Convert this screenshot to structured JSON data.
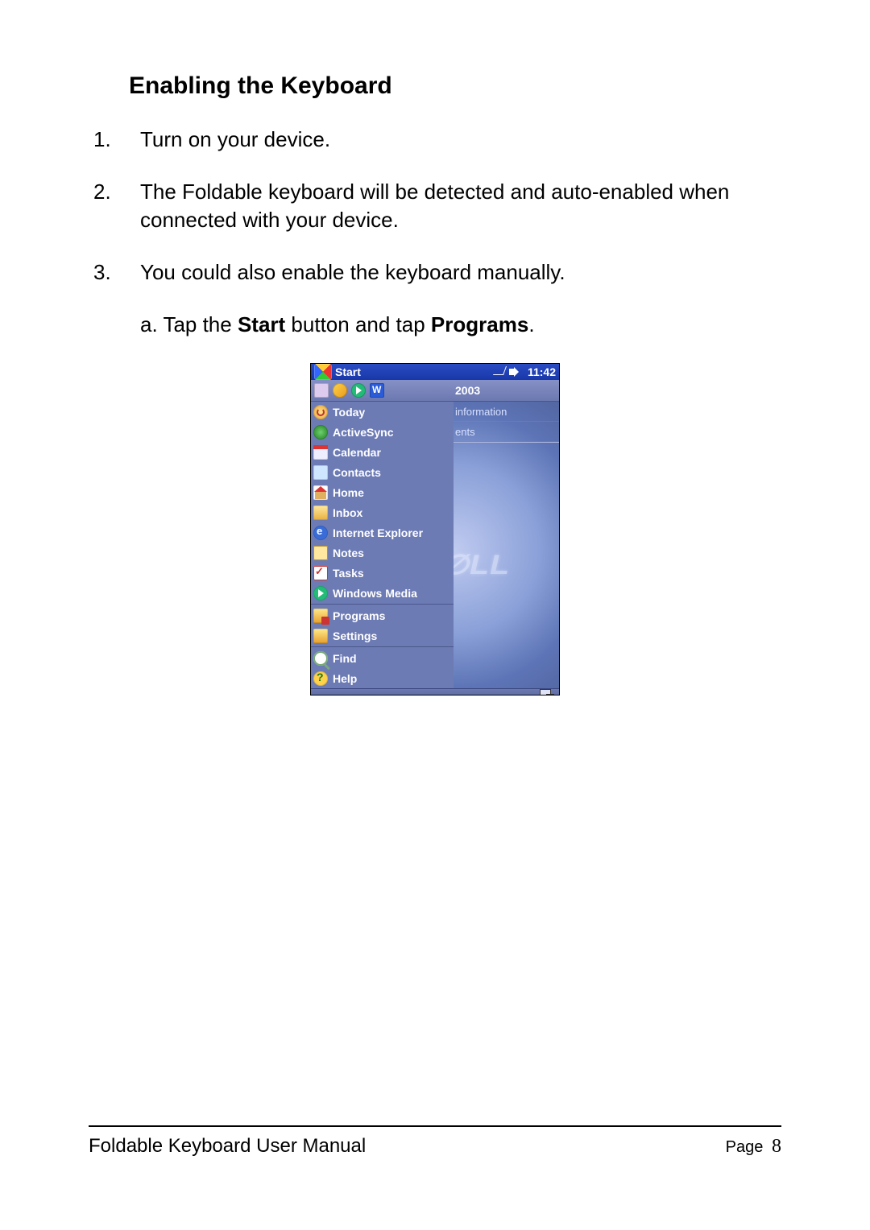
{
  "doc": {
    "heading": "Enabling the Keyboard",
    "steps": [
      {
        "n": "1.",
        "text": "Turn on your device."
      },
      {
        "n": "2.",
        "text": "The Foldable keyboard will be detected and auto-enabled when connected with your device."
      },
      {
        "n": "3.",
        "text": "You could also enable the keyboard manually."
      }
    ],
    "substep_prefix": "a.  Tap the ",
    "substep_bold1": "Start",
    "substep_mid": " button and tap ",
    "substep_bold2": "Programs",
    "substep_suffix": "."
  },
  "ppc": {
    "title": "Start",
    "clock": "11:42",
    "launch_year": "2003",
    "right_rows": [
      "information",
      "ents"
    ],
    "brand": "D∅LL",
    "menu": {
      "recent": [
        {
          "k": "today",
          "label": "Today"
        },
        {
          "k": "sync",
          "label": "ActiveSync"
        },
        {
          "k": "cal2",
          "label": "Calendar"
        },
        {
          "k": "contacts",
          "label": "Contacts"
        },
        {
          "k": "home",
          "label": "Home"
        },
        {
          "k": "inbox",
          "label": "Inbox"
        },
        {
          "k": "ie",
          "label": "Internet Explorer"
        },
        {
          "k": "notes",
          "label": "Notes"
        },
        {
          "k": "tasks",
          "label": "Tasks"
        },
        {
          "k": "media",
          "label": "Windows Media"
        }
      ],
      "system": [
        {
          "k": "programs",
          "label": "Programs"
        },
        {
          "k": "settings",
          "label": "Settings"
        }
      ],
      "utility": [
        {
          "k": "find",
          "label": "Find"
        },
        {
          "k": "help",
          "label": "Help"
        }
      ]
    }
  },
  "footer": {
    "title": "Foldable Keyboard User Manual",
    "page_label": "Page",
    "page_num": "8"
  }
}
